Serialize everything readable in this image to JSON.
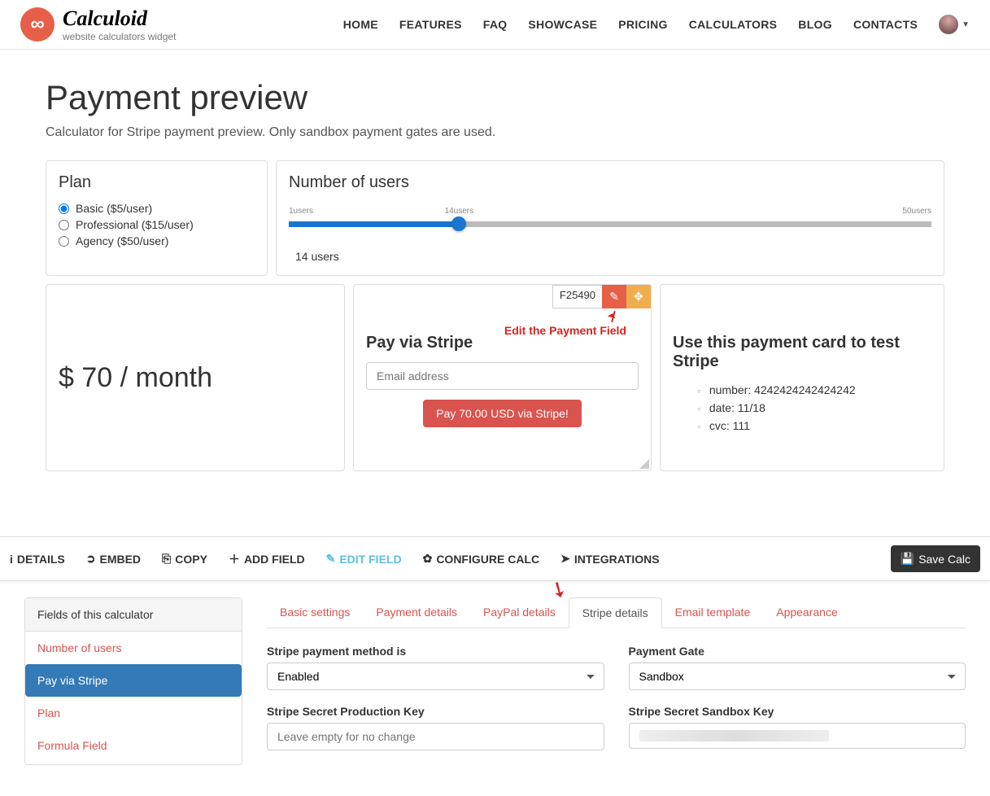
{
  "brand": {
    "name": "Calculoid",
    "tagline": "website calculators widget"
  },
  "nav": {
    "home": "HOME",
    "features": "FEATURES",
    "faq": "FAQ",
    "showcase": "SHOWCASE",
    "pricing": "PRICING",
    "calculators": "CALCULATORS",
    "blog": "BLOG",
    "contacts": "CONTACTS"
  },
  "page": {
    "title": "Payment preview",
    "subtitle": "Calculator for Stripe payment preview. Only sandbox payment gates are used."
  },
  "plan": {
    "title": "Plan",
    "options": [
      "Basic ($5/user)",
      "Professional ($15/user)",
      "Agency ($50/user)"
    ],
    "selected": 0
  },
  "users": {
    "title": "Number of users",
    "min_label": "1users",
    "cur_label": "14users",
    "max_label": "50users",
    "value_text": "14  users"
  },
  "price": {
    "text": "$ 70 / month"
  },
  "stripe": {
    "field_id": "F25490",
    "annotation": "Edit the Payment Field",
    "title": "Pay via Stripe",
    "email_placeholder": "Email address",
    "pay_button": "Pay 70.00 USD via Stripe!"
  },
  "testcard": {
    "title": "Use this payment card to test Stripe",
    "items": [
      "number: 4242424242424242",
      "date: 11/18",
      "cvc: 111"
    ]
  },
  "toolbar": {
    "details": "DETAILS",
    "embed": "EMBED",
    "copy": "COPY",
    "add_field": "ADD FIELD",
    "edit_field": "EDIT FIELD",
    "configure": "CONFIGURE CALC",
    "integrations": "INTEGRATIONS",
    "save": "Save Calc"
  },
  "fields_panel": {
    "title": "Fields of this calculator",
    "items": [
      "Number of users",
      "Pay via Stripe",
      "Plan",
      "Formula Field"
    ],
    "active": 1
  },
  "tabs": {
    "basic": "Basic settings",
    "payment": "Payment details",
    "paypal": "PayPal details",
    "stripe": "Stripe details",
    "email": "Email template",
    "appearance": "Appearance"
  },
  "form": {
    "method_label": "Stripe payment method is",
    "method_value": "Enabled",
    "gate_label": "Payment Gate",
    "gate_value": "Sandbox",
    "prod_key_label": "Stripe Secret Production Key",
    "prod_key_placeholder": "Leave empty for no change",
    "sandbox_key_label": "Stripe Secret Sandbox Key"
  }
}
